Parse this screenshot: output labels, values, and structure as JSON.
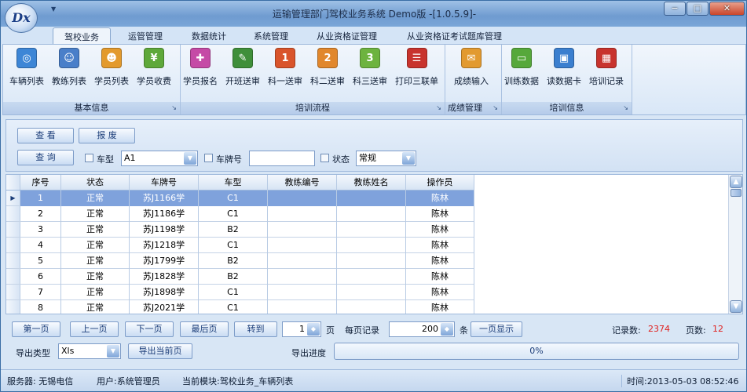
{
  "app": {
    "title": "运输管理部门驾校业务系统 Demo版 -[1.0.5.9]-",
    "logo_text": "Dx",
    "quick_access": "▼"
  },
  "window_buttons": {
    "minimize": "−",
    "maximize": "□",
    "close": "✕"
  },
  "tabs": [
    "驾校业务",
    "运管管理",
    "数据统计",
    "系统管理",
    "从业资格证管理",
    "从业资格证考试题库管理"
  ],
  "ribbon": {
    "groups": [
      {
        "title": "基本信息",
        "buttons": [
          {
            "label": "车辆列表",
            "icon": "car-icon",
            "color": "#3d86d6"
          },
          {
            "label": "教练列表",
            "icon": "coach-icon",
            "color": "#4a7fc9"
          },
          {
            "label": "学员列表",
            "icon": "students-icon",
            "color": "#e39a2c"
          },
          {
            "label": "学员收费",
            "icon": "fee-icon",
            "color": "#5ea83a"
          }
        ]
      },
      {
        "title": "培训流程",
        "buttons": [
          {
            "label": "学员报名",
            "icon": "signup-icon",
            "color": "#c54aa6"
          },
          {
            "label": "开班送审",
            "icon": "class-icon",
            "color": "#3f8f3a"
          },
          {
            "label": "科一送审",
            "icon": "subject1-icon",
            "color": "#d9542b"
          },
          {
            "label": "科二送审",
            "icon": "subject2-icon",
            "color": "#e1872c"
          },
          {
            "label": "科三送审",
            "icon": "subject3-icon",
            "color": "#6db33f"
          },
          {
            "label": "打印三联单",
            "icon": "print-icon",
            "color": "#c8332d"
          }
        ]
      },
      {
        "title": "成绩管理",
        "buttons": [
          {
            "label": "成绩输入",
            "icon": "score-input-icon",
            "color": "#e29a30"
          }
        ]
      },
      {
        "title": "培训信息",
        "buttons": [
          {
            "label": "训练数据",
            "icon": "training-data-icon",
            "color": "#56a83b"
          },
          {
            "label": "读数据卡",
            "icon": "card-reader-icon",
            "color": "#3b7fcf"
          },
          {
            "label": "培训记录",
            "icon": "records-icon",
            "color": "#c8332d"
          }
        ]
      }
    ],
    "launcher": "↘"
  },
  "filters": {
    "view_button": "查 看",
    "discard_button": "报 废",
    "query_button": "查 询",
    "vehicle_type_label": "车型",
    "vehicle_type_value": "A1",
    "plate_label": "车牌号",
    "plate_value": "",
    "status_label": "状态",
    "status_value": "常规"
  },
  "grid": {
    "columns": [
      "序号",
      "状态",
      "车牌号",
      "车型",
      "教练编号",
      "教练姓名",
      "操作员"
    ],
    "rows": [
      [
        "1",
        "正常",
        "苏J1166学",
        "C1",
        "",
        "",
        "陈林"
      ],
      [
        "2",
        "正常",
        "苏J1186学",
        "C1",
        "",
        "",
        "陈林"
      ],
      [
        "3",
        "正常",
        "苏J1198学",
        "B2",
        "",
        "",
        "陈林"
      ],
      [
        "4",
        "正常",
        "苏J1218学",
        "C1",
        "",
        "",
        "陈林"
      ],
      [
        "5",
        "正常",
        "苏J1799学",
        "B2",
        "",
        "",
        "陈林"
      ],
      [
        "6",
        "正常",
        "苏J1828学",
        "B2",
        "",
        "",
        "陈林"
      ],
      [
        "7",
        "正常",
        "苏J1898学",
        "C1",
        "",
        "",
        "陈林"
      ],
      [
        "8",
        "正常",
        "苏J2021学",
        "C1",
        "",
        "",
        "陈林"
      ]
    ],
    "selected_marker": "▶"
  },
  "pager": {
    "first": "第一页",
    "prev": "上一页",
    "next": "下一页",
    "last": "最后页",
    "goto": "转到",
    "page_value": "1",
    "page_unit": "页",
    "per_page_label": "每页记录",
    "per_page_value": "200",
    "per_page_unit": "条",
    "one_page": "一页显示",
    "record_count_label": "记录数:",
    "record_count": "2374",
    "page_count_label": "页数:",
    "page_count": "12"
  },
  "export": {
    "type_label": "导出类型",
    "type_value": "Xls",
    "export_button": "导出当前页",
    "progress_label": "导出进度",
    "progress_text": "0%",
    "progress": 0
  },
  "status": {
    "server": "服务器: 无锡电信",
    "user": "用户:系统管理员",
    "module": "当前模块:驾校业务_车辆列表",
    "time": "时间:2013-05-03 08:52:46"
  }
}
